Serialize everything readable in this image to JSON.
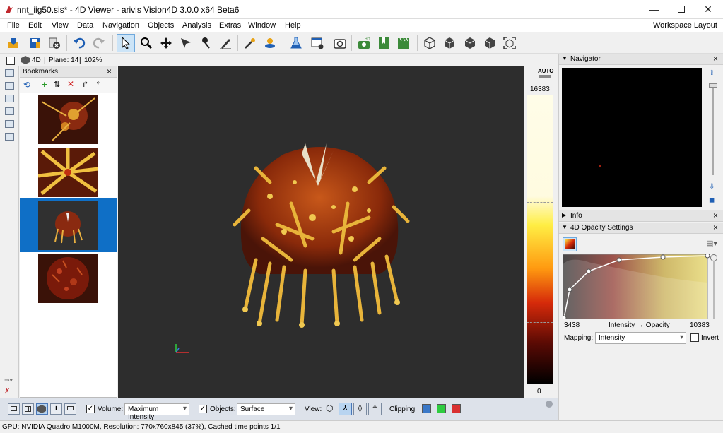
{
  "window": {
    "title": "nnt_iig50.sis* - 4D Viewer - arivis Vision4D 3.0.0 x64 Beta6",
    "min_icon": "minimize-icon",
    "max_icon": "maximize-icon",
    "close_icon": "close-icon"
  },
  "menu": [
    "File",
    "Edit",
    "View",
    "Data",
    "Navigation",
    "Objects",
    "Analysis",
    "Extras",
    "Window",
    "Help"
  ],
  "workspace_layout": "Workspace Layout",
  "viewinfo": {
    "mode": "4D",
    "plane": "Plane: 14",
    "zoom": "102%"
  },
  "bookmarks": {
    "title": "Bookmarks"
  },
  "colorbar": {
    "auto": "AUTO",
    "max": "16383",
    "min": "0"
  },
  "navigator": {
    "title": "Navigator"
  },
  "info": {
    "title": "Info"
  },
  "opacity": {
    "title": "4D Opacity Settings",
    "min": "3438",
    "max": "10383",
    "axis": "Intensity → Opacity",
    "mapping_label": "Mapping:",
    "mapping_value": "Intensity",
    "invert_label": "Invert"
  },
  "bottom": {
    "volume_label": "Volume:",
    "volume_value": "Maximum Intensity",
    "objects_label": "Objects:",
    "objects_value": "Surface",
    "view_label": "View:",
    "clipping_label": "Clipping:",
    "clip_colors": [
      "#3a78c8",
      "#2ecc40",
      "#d93030"
    ]
  },
  "status": "GPU: NVIDIA Quadro M1000M, Resolution: 770x760x845 (37%), Cached time points 1/1"
}
